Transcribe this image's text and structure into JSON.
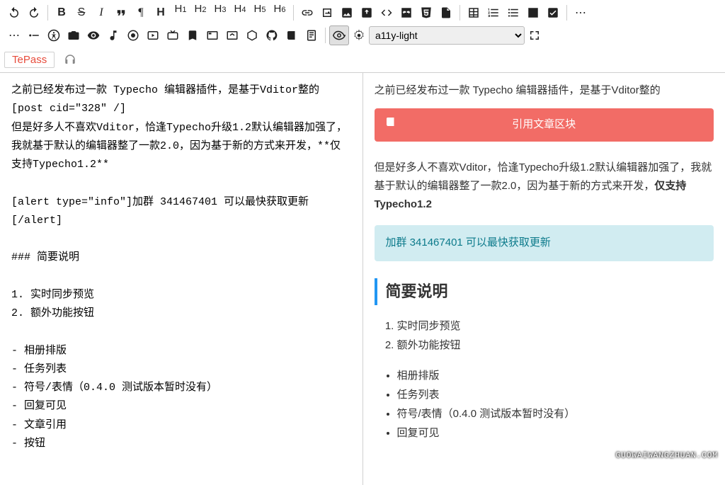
{
  "toolbar": {
    "row1": {
      "undo": "↶",
      "redo": "↷",
      "bold": "B",
      "strike": "S",
      "italic": "I",
      "quote_glyph": "❝",
      "paragraph": "¶",
      "heading": "H",
      "h1": "H₁",
      "h2": "H₂",
      "h3": "H₃",
      "h4": "H₄",
      "h5": "H₅",
      "h6": "H₆",
      "check": "✔",
      "more": "⋯"
    },
    "row2": {
      "more": "⋯"
    },
    "theme_select": "a11y-light",
    "tepass_label": "TePass"
  },
  "source": "之前已经发布过一款 Typecho 编辑器插件，是基于Vditor整的\n[post cid=\"328\" /]\n但是好多人不喜欢Vditor，恰逢Typecho升级1.2默认编辑器加强了，我就基于默认的编辑器整了一款2.0，因为基于新的方式来开发，**仅支持Typecho1.2**\n\n[alert type=\"info\"]加群 341467401 可以最快获取更新[/alert]\n\n### 简要说明\n\n1. 实时同步预览\n2. 额外功能按钮\n\n- 相册排版\n- 任务列表\n- 符号/表情（0.4.0 测试版本暂时没有）\n- 回复可见\n- 文章引用\n- 按钮",
  "preview": {
    "p1": "之前已经发布过一款 Typecho 编辑器插件，是基于Vditor整的",
    "quote_block": "引用文章区块",
    "p2_prefix": "但是好多人不喜欢Vditor，恰逢Typecho升级1.2默认编辑器加强了，我就基于默认的编辑器整了一款2.0，因为基于新的方式来开发，",
    "p2_bold": "仅支持Typecho1.2",
    "alert": "加群 341467401 可以最快获取更新",
    "h3": "简要说明",
    "ol": [
      "实时同步预览",
      "额外功能按钮"
    ],
    "ul": [
      "相册排版",
      "任务列表",
      "符号/表情（0.4.0 测试版本暂时没有）",
      "回复可见"
    ]
  },
  "watermark": "GUOWAIWANGZHUAN.COM"
}
